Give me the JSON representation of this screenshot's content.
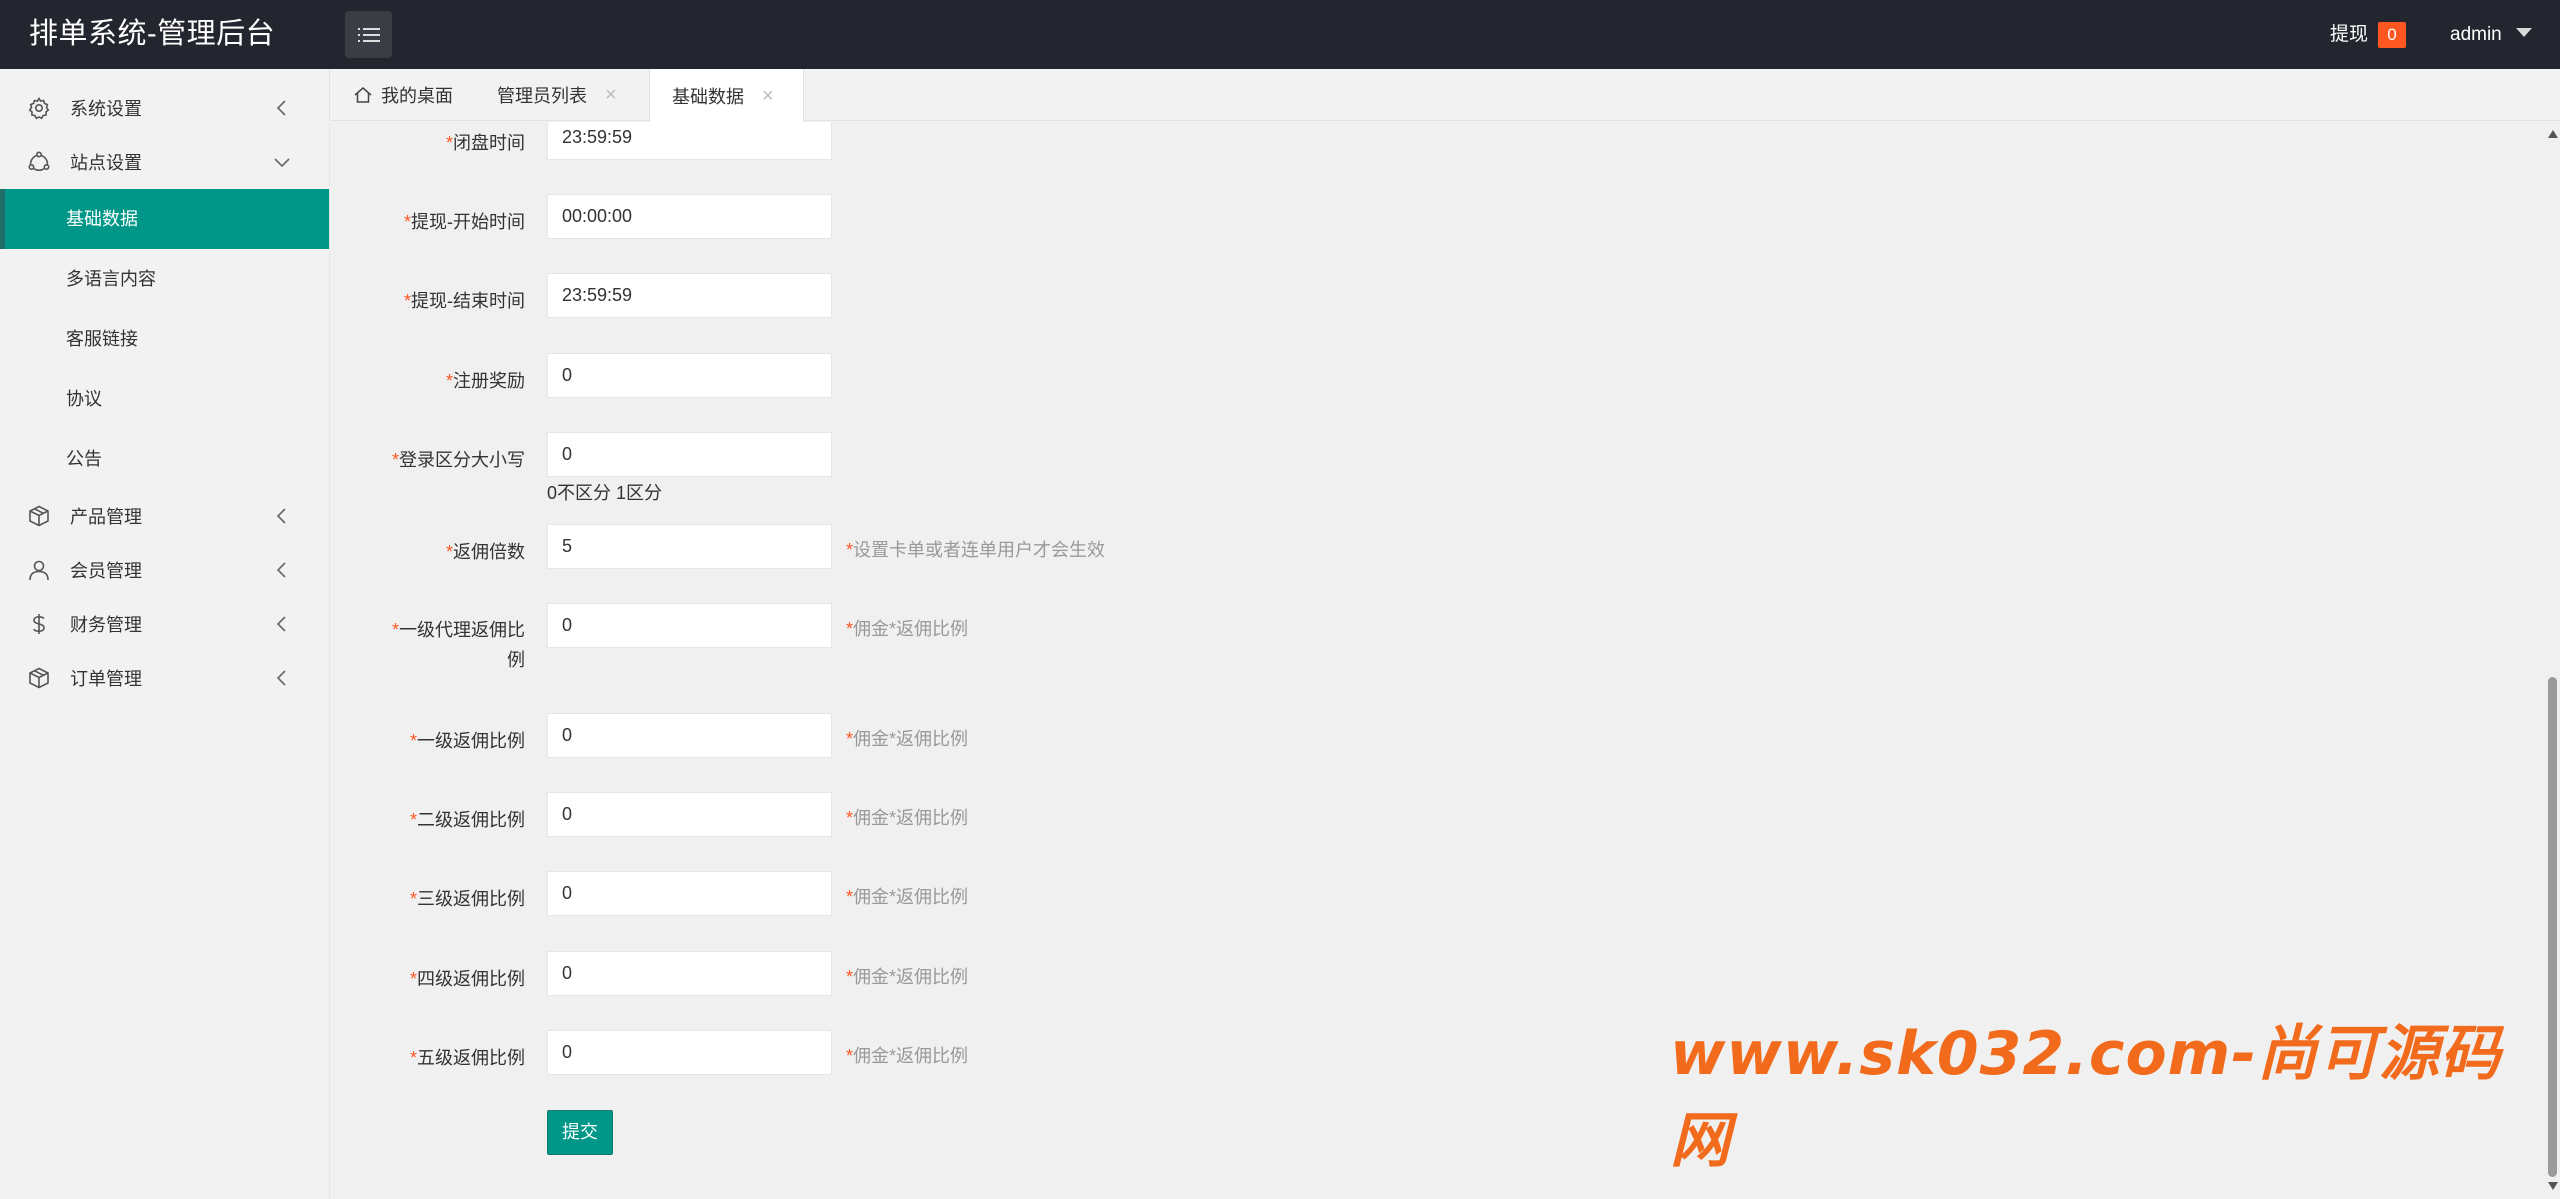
{
  "header": {
    "title": "排单系统-管理后台",
    "withdraw_label": "提现",
    "withdraw_count": "0",
    "user": "admin"
  },
  "sidebar": {
    "groups": [
      {
        "label": "系统设置",
        "icon": "gear-icon"
      },
      {
        "label": "站点设置",
        "icon": "site-icon"
      },
      {
        "label": "产品管理",
        "icon": "box-icon"
      },
      {
        "label": "会员管理",
        "icon": "user-icon"
      },
      {
        "label": "财务管理",
        "icon": "dollar-icon"
      },
      {
        "label": "订单管理",
        "icon": "box-icon"
      }
    ],
    "sub_items": [
      "基础数据",
      "多语言内容",
      "客服链接",
      "协议",
      "公告"
    ]
  },
  "tabs": [
    {
      "label": "我的桌面",
      "icon": "home-icon"
    },
    {
      "label": "管理员列表",
      "close": "×"
    },
    {
      "label": "基础数据",
      "close": "×"
    }
  ],
  "form": {
    "fields": [
      {
        "label": "闭盘时间",
        "value": "23:59:59"
      },
      {
        "label": "提现-开始时间",
        "value": "00:00:00"
      },
      {
        "label": "提现-结束时间",
        "value": "23:59:59"
      },
      {
        "label": "注册奖励",
        "value": "0"
      },
      {
        "label": "登录区分大小写",
        "value": "0",
        "note": "0不区分 1区分"
      },
      {
        "label": "返佣倍数",
        "value": "5",
        "hint": "设置卡单或者连单用户才会生效"
      },
      {
        "label_line1": "一级代理返佣比",
        "label_line2": "例",
        "value": "0",
        "hint": "佣金*返佣比例"
      },
      {
        "label": "一级返佣比例",
        "value": "0",
        "hint": "佣金*返佣比例"
      },
      {
        "label": "二级返佣比例",
        "value": "0",
        "hint": "佣金*返佣比例"
      },
      {
        "label": "三级返佣比例",
        "value": "0",
        "hint": "佣金*返佣比例"
      },
      {
        "label": "四级返佣比例",
        "value": "0",
        "hint": "佣金*返佣比例"
      },
      {
        "label": "五级返佣比例",
        "value": "0",
        "hint": "佣金*返佣比例"
      }
    ],
    "required_mark": "*",
    "submit_label": "提交"
  },
  "watermark": "www.sk032.com-尚可源码网",
  "colors": {
    "header_bg": "#23262e",
    "accent": "#009688",
    "badge": "#ff5722",
    "watermark": "#f26b1d"
  }
}
